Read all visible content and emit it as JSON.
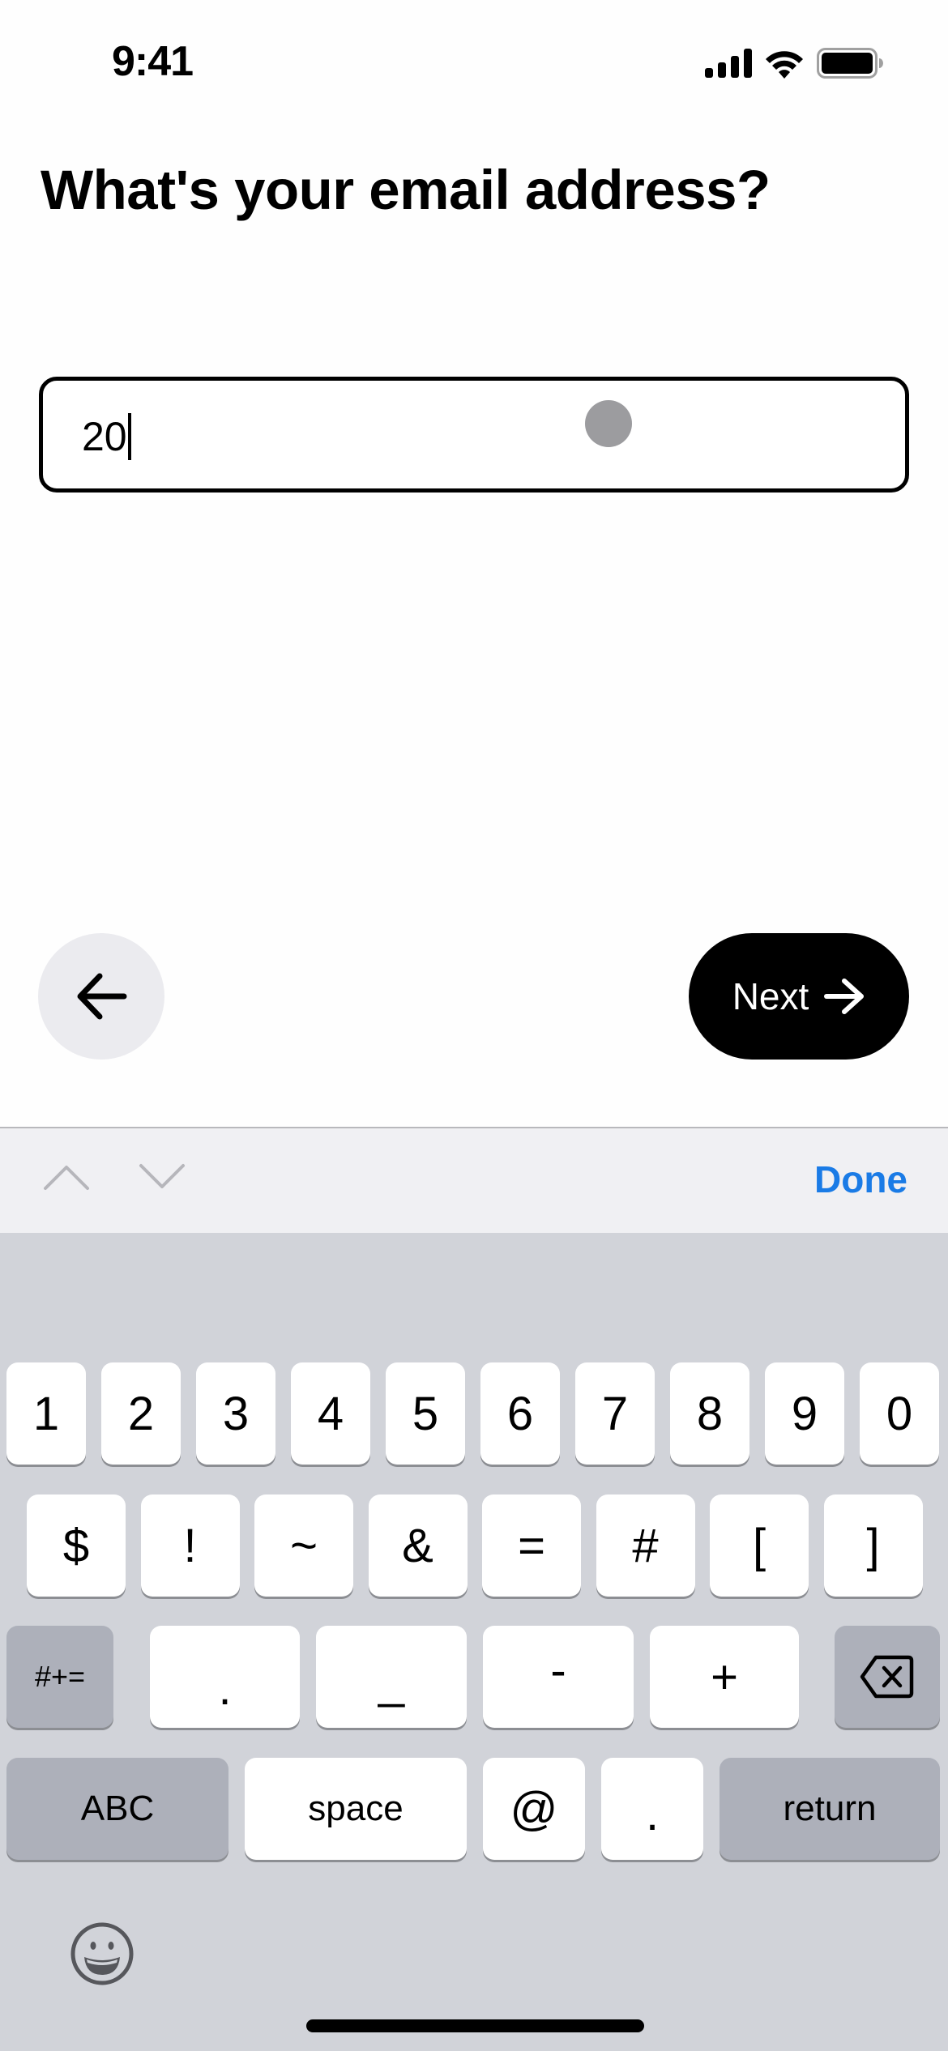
{
  "status_bar": {
    "time": "9:41",
    "icons": [
      "cellular-signal-icon",
      "wifi-icon",
      "battery-icon"
    ]
  },
  "page": {
    "title": "What's your email address?"
  },
  "email_field": {
    "value": "20",
    "placeholder": ""
  },
  "navigation": {
    "back_icon": "arrow-left-icon",
    "next_label": "Next",
    "next_icon": "arrow-right-icon"
  },
  "keyboard_toolbar": {
    "prev_icon": "chevron-up-icon",
    "next_icon": "chevron-down-icon",
    "done_label": "Done",
    "accent_color": "#1a7be6"
  },
  "keyboard": {
    "row1": [
      "1",
      "2",
      "3",
      "4",
      "5",
      "6",
      "7",
      "8",
      "9",
      "0"
    ],
    "row2": [
      "$",
      "!",
      "~",
      "&",
      "=",
      "#",
      "[",
      "]"
    ],
    "row3": {
      "shift_label": "#+=",
      "keys": [
        ".",
        "_",
        "-",
        "+"
      ],
      "delete_icon": "backspace-icon"
    },
    "row4": {
      "abc_label": "ABC",
      "space_label": "space",
      "at_label": "@",
      "dot_label": ".",
      "return_label": "return"
    },
    "emoji_icon": "emoji-icon"
  }
}
